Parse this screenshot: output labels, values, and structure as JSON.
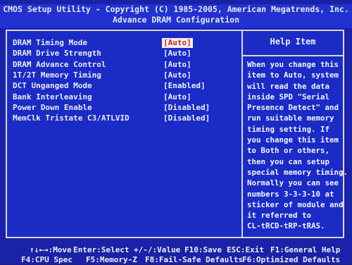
{
  "header": {
    "line1": "CMOS Setup Utility - Copyright (C) 1985-2005, American Megatrends, Inc.",
    "line2": "Advance DRAM Configuration"
  },
  "settings": [
    {
      "label": "DRAM Timing Mode",
      "value": "[Auto]",
      "selected": true
    },
    {
      "label": "DRAM Drive Strength",
      "value": "[Auto]"
    },
    {
      "label": "DRAM Advance Control",
      "value": "[Auto]"
    },
    {
      "label": "1T/2T Memory Timing",
      "value": "[Auto]"
    },
    {
      "label": "DCT Unganged Mode",
      "value": "[Enabled]"
    },
    {
      "label": "Bank Interleaving",
      "value": "[Auto]"
    },
    {
      "label": "Power Down Enable",
      "value": "[Disabled]"
    },
    {
      "label": "MemClk Tristate C3/ATLVID",
      "value": "[Disabled]"
    }
  ],
  "help": {
    "title": "Help Item",
    "lines": [
      "When you change this",
      "item to Auto, system",
      "will read the data",
      "inside SPD \"Serial",
      "Presence Detect\" and",
      "run suitable memory",
      "timing setting. If",
      "you change this item",
      "to Both or others,",
      "then you can setup",
      "special memory timing.",
      "Normally you can see",
      "numbers 3-3-3-10 at",
      "sticker of module and",
      "it referred to",
      "CL-tRCD-tRP-tRAS."
    ]
  },
  "footer": {
    "move": "↑↓←→:Move",
    "select": "Enter:Select",
    "value": "+/-/:Value",
    "save": "F10:Save",
    "exit": "ESC:Exit",
    "help": "F1:General Help",
    "cpu": "F4:CPU Spec",
    "memz": "F5:Memory-Z",
    "failsafe": "F8:Fail-Safe Defaults",
    "optimized": "F6:Optimized Defaults"
  }
}
